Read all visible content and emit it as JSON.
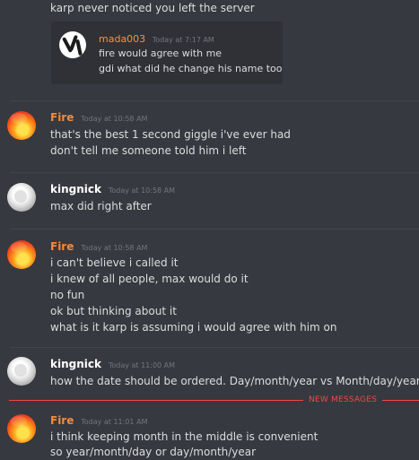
{
  "colors": {
    "background": "#36393f",
    "text": "#dcddde",
    "timestamp": "#72767d",
    "fire_name": "#f58a3d",
    "kingnick_name": "#ffffff",
    "mada_name": "#ff8f3f",
    "new_messages": "#f04747",
    "embed_bg": "#2f3136"
  },
  "intro": {
    "text": "karp never noticed you left the server"
  },
  "quoted": {
    "username": "mada003",
    "timestamp": "Today at 7:17 AM",
    "avatar_icon": "anime-avatar-icon",
    "lines": [
      "fire would agree with me",
      "gdi what did he change his name too"
    ]
  },
  "messages": [
    {
      "username": "Fire",
      "timestamp": "Today at 10:58 AM",
      "avatar_icon": "fire-avatar-icon",
      "lines": [
        "that's the best 1 second giggle i've ever had",
        "don't tell me someone told him i left"
      ]
    },
    {
      "username": "kingnick",
      "timestamp": "Today at 10:58 AM",
      "avatar_icon": "kingnick-avatar-icon",
      "lines": [
        "max did right after"
      ]
    },
    {
      "username": "Fire",
      "timestamp": "Today at 10:58 AM",
      "avatar_icon": "fire-avatar-icon",
      "lines": [
        "i can't believe i called it",
        "i knew of all people, max would do it",
        "no fun",
        "ok but thinking about it",
        "what is it karp is assuming i would agree with him on"
      ]
    },
    {
      "username": "kingnick",
      "timestamp": "Today at 11:00 AM",
      "avatar_icon": "kingnick-avatar-icon",
      "lines": [
        "how the date should be ordered. Day/month/year vs Month/day/year"
      ]
    },
    {
      "username": "Fire",
      "timestamp": "Today at 11:01 AM",
      "avatar_icon": "fire-avatar-icon",
      "lines": [
        "i think keeping month in the middle is convenient",
        "so year/month/day or day/month/year"
      ]
    }
  ],
  "new_messages": {
    "label": "NEW MESSAGES"
  }
}
